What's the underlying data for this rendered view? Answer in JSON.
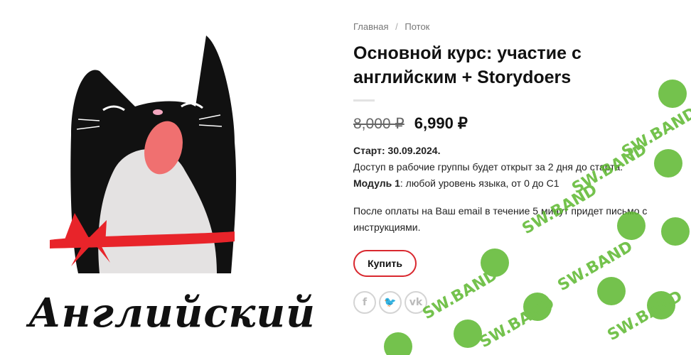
{
  "breadcrumb": {
    "home": "Главная",
    "separator": "/",
    "current": "Поток"
  },
  "product": {
    "title": "Основной курс: участие с английским + Storydoers",
    "old_price": "8,000 ₽",
    "price": "6,990 ₽",
    "start": "Старт: 30.09.2024.",
    "access": "Доступ в рабочие группы будет открыт за 2 дня до старта.",
    "module_label": "Модуль 1",
    "module_text": ": любой уровень языка, от 0 до С1",
    "after_payment": "После оплаты на Ваш email в течение 5 минут придет письмо с инструкциями."
  },
  "image": {
    "caption": "Английский",
    "accent": "#e8242a",
    "nose": "#f07070"
  },
  "buy_button": {
    "label": "Купить",
    "border_color": "#d9282f"
  },
  "share": [
    {
      "icon": "facebook-icon",
      "glyph": "f"
    },
    {
      "icon": "twitter-icon",
      "glyph": "🐦"
    },
    {
      "icon": "vk-icon",
      "glyph": "vk"
    }
  ],
  "watermark": {
    "text": "SW.BAND",
    "color": "#5cb82e"
  }
}
